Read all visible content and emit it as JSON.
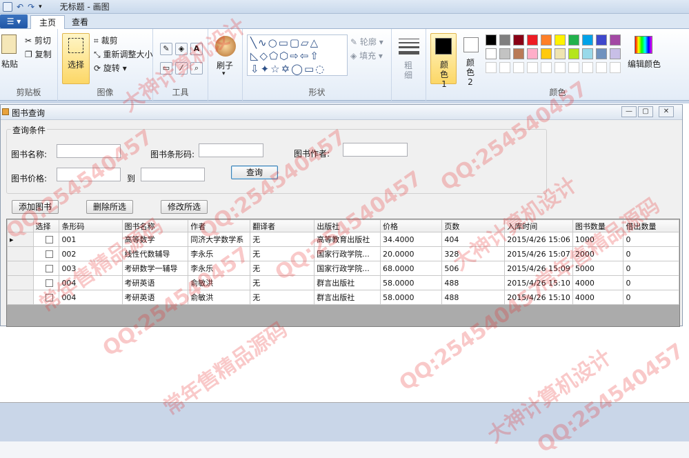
{
  "app": {
    "title": "无标题 - 画图"
  },
  "ribbon": {
    "file_label": "",
    "tabs": [
      {
        "label": "主页",
        "active": true
      },
      {
        "label": "查看",
        "active": false
      }
    ],
    "clipboard": {
      "paste": "粘贴",
      "cut": "剪切",
      "copy": "复制",
      "group": "剪贴板"
    },
    "image": {
      "select": "选择",
      "crop": "裁剪",
      "resize": "重新调整大小",
      "rotate": "旋转",
      "group": "图像"
    },
    "tools": {
      "group": "工具"
    },
    "brush": {
      "label": "刷子"
    },
    "shapes": {
      "outline": "轮廓",
      "fill": "填充",
      "group": "形状"
    },
    "size": {
      "label_a": "粗",
      "label_b": "细"
    },
    "colors": {
      "color1": "颜色 1",
      "color2": "颜色 2",
      "edit": "编辑颜色",
      "group": "颜色",
      "palette": [
        "#000000",
        "#7f7f7f",
        "#880015",
        "#ed1c24",
        "#ff7f27",
        "#fff200",
        "#22b14c",
        "#00a2e8",
        "#3f48cc",
        "#a349a4",
        "#ffffff",
        "#c3c3c3",
        "#b97a57",
        "#ffaec9",
        "#ffc90e",
        "#efe4b0",
        "#b5e61d",
        "#99d9ea",
        "#7092be",
        "#c8bfe7"
      ]
    }
  },
  "window": {
    "title": "图书查询",
    "search_group": "查询条件",
    "labels": {
      "book_name": "图书名称:",
      "barcode": "图书条形码:",
      "author": "图书作者:",
      "price": "图书价格:",
      "to": "到"
    },
    "query_button": "查询",
    "add_button": "添加图书",
    "delete_button": "删除所选",
    "edit_button": "修改所选"
  },
  "grid": {
    "columns": [
      "选择",
      "条形码",
      "图书名称",
      "作者",
      "翻译者",
      "出版社",
      "价格",
      "页数",
      "入库时间",
      "图书数量",
      "借出数量"
    ],
    "rows": [
      [
        "001",
        "高等数学",
        "同济大学数学系",
        "无",
        "高等教育出版社",
        "34.4000",
        "404",
        "2015/4/26 15:06",
        "1000",
        "0"
      ],
      [
        "002",
        "线性代数辅导",
        "李永乐",
        "无",
        "国家行政学院...",
        "20.0000",
        "328",
        "2015/4/26 15:07",
        "2000",
        "0"
      ],
      [
        "003",
        "考研数学一辅导",
        "李永乐",
        "无",
        "国家行政学院...",
        "68.0000",
        "506",
        "2015/4/26 15:09",
        "5000",
        "0"
      ],
      [
        "004",
        "考研英语",
        "俞敏洪",
        "无",
        "群言出版社",
        "58.0000",
        "488",
        "2015/4/26 15:10",
        "4000",
        "0"
      ],
      [
        "004",
        "考研英语",
        "俞敏洪",
        "无",
        "群言出版社",
        "58.0000",
        "488",
        "2015/4/26 15:10",
        "4000",
        "0"
      ]
    ]
  },
  "watermarks": [
    "QQ:254540457",
    "常年售精品源码",
    "大神计算机设计"
  ]
}
